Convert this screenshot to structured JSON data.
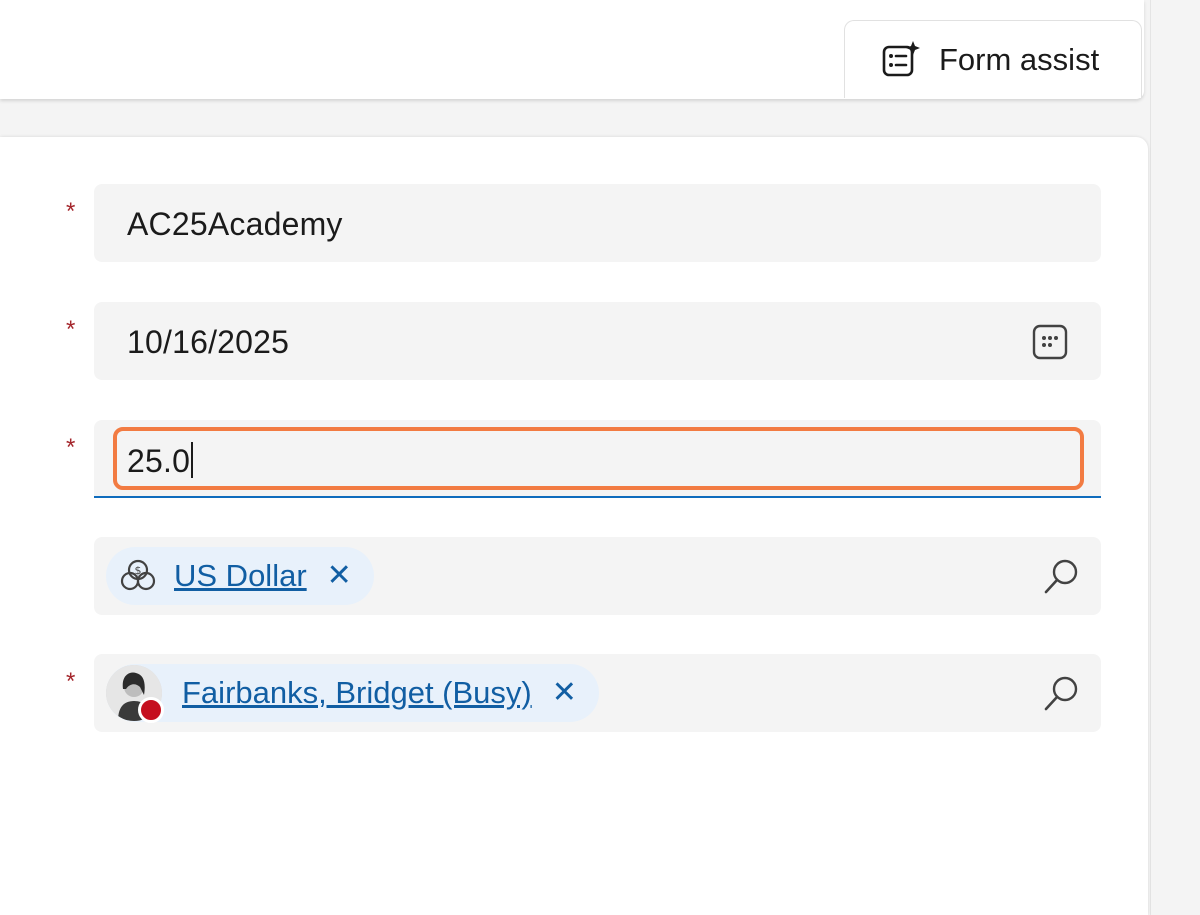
{
  "header": {
    "form_assist_label": "Form assist",
    "form_assist_icon": "form-sparkle-icon"
  },
  "fields": {
    "name": {
      "required_mark": "*",
      "value": "AC25Academy"
    },
    "date": {
      "required_mark": "*",
      "value": "10/16/2025",
      "icon": "calendar-icon"
    },
    "amount": {
      "required_mark": "*",
      "value": "25.0"
    },
    "currency": {
      "tag_label": "US Dollar",
      "tag_icon": "currency-icon",
      "remove": "✕",
      "search_icon": "search-icon"
    },
    "owner": {
      "required_mark": "*",
      "tag_label": "Fairbanks, Bridget (Busy)",
      "remove": "✕",
      "presence": "busy",
      "search_icon": "search-icon"
    }
  },
  "colors": {
    "required": "#a4262c",
    "link": "#115ea3",
    "focus_ring": "#f27b42",
    "underline_active": "#0f6cbd",
    "presence_busy": "#c50f1f"
  }
}
